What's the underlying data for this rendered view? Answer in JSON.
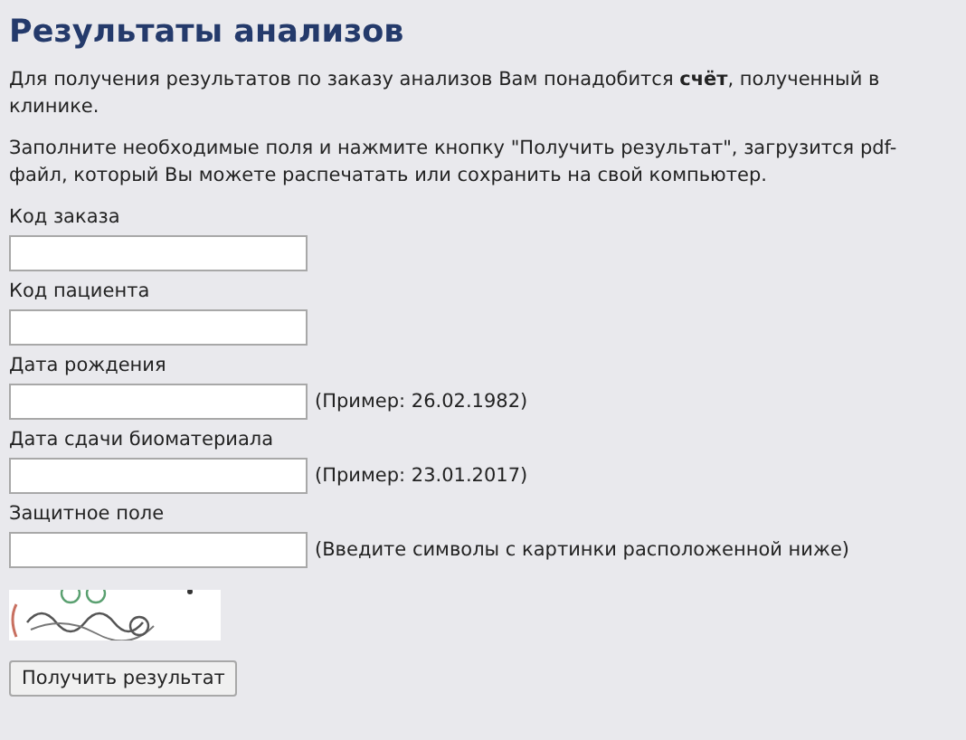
{
  "title": "Результаты анализов",
  "paragraphs": [
    "Для получения результатов по заказу анализов Вам понадобится **счёт**, полученный в клинике.",
    "Заполните необходимые поля и нажмите кнопку \"Получить результат\", загрузится pdf-файл, который Вы можете распечатать или сохранить на свой компьютер."
  ],
  "fields": [
    {
      "label": "Код заказа"
    },
    {
      "label": "Код пациента"
    },
    {
      "label": "Дата рождения",
      "hint": "(Пример: 26.02.1982)"
    },
    {
      "label": "Дата сдачи биоматериала",
      "hint": "(Пример: 23.01.2017)"
    },
    {
      "label": "Защитное поле",
      "hint": "(Введите символы с картинки расположенной ниже)"
    }
  ],
  "submit_button": "Получить результат"
}
